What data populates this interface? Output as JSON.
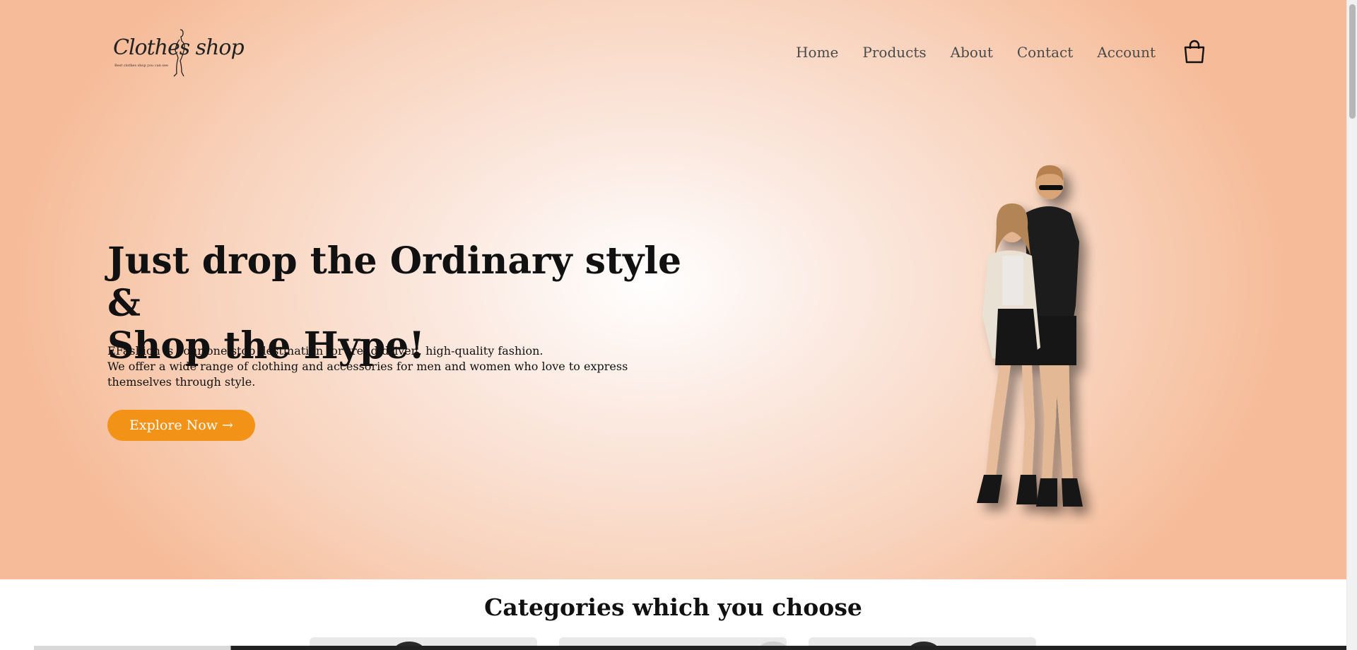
{
  "header": {
    "logo": {
      "text": "Clothes shop",
      "tagline": "Best clothes shop you can see"
    },
    "nav": [
      {
        "label": "Home"
      },
      {
        "label": "Products"
      },
      {
        "label": "About"
      },
      {
        "label": "Contact"
      },
      {
        "label": "Account"
      }
    ],
    "cart_icon": "shopping-bag-icon"
  },
  "hero": {
    "headline_line1": "Just drop the Ordinary style &",
    "headline_line2": "Shop the Hype!",
    "description_line1": "EFashion is your one-stop destination for trend-driven, high-quality fashion.",
    "description_line2": "We offer a wide range of clothing and accessories for men and women who love to express themselves through style.",
    "cta_label": "Explore Now →",
    "image": "couple-models-photo"
  },
  "categories": {
    "title": "Categories which you choose",
    "cards": [
      {
        "image": "category-photo"
      },
      {
        "image": "category-photo"
      },
      {
        "image": "category-photo"
      }
    ]
  },
  "colors": {
    "accent": "#f29216",
    "hero_background": "#f6bc99",
    "text": "#111111",
    "nav_text": "#4a4a4a"
  }
}
